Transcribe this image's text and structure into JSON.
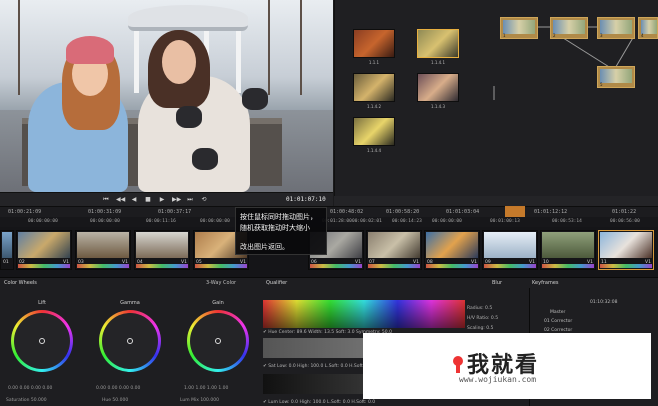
{
  "viewer": {
    "timecode": "01:01:07:10"
  },
  "transport": {
    "controls": [
      "⏮",
      "◀◀",
      "◀",
      "■",
      "▶",
      "▶▶",
      "⏭",
      "⟲"
    ]
  },
  "gallery": {
    "stills": [
      {
        "label": "1.1.1"
      },
      {
        "label": "1.1.4.1"
      },
      {
        "label": "1.1.4.2"
      },
      {
        "label": "1.1.4.3"
      },
      {
        "label": "1.1.4.4"
      }
    ]
  },
  "nodes": [
    {
      "label": "1"
    },
    {
      "label": "2"
    },
    {
      "label": "3"
    },
    {
      "label": "4"
    },
    {
      "label": "5"
    }
  ],
  "timeline": {
    "ruler_ticks": [
      "01:00:21:09",
      "01:00:31:09",
      "01:00:37:17",
      "01:00:48:02",
      "01:00:58:20",
      "01:01:03:04",
      "01:01:12:12",
      "01:01:22"
    ],
    "clip_times": [
      "00:00:00:00",
      "00:00:00:00",
      "00:00:11:16",
      "00:00:00:00",
      "00:01:28:00",
      "00:00:02:01",
      "00:00:14:23",
      "00:00:00:00",
      "00:01:00:13",
      "00:00:53:14",
      "00:00:56:00"
    ],
    "clips": [
      {
        "num": "01",
        "codec": ""
      },
      {
        "num": "02",
        "codec": "V1"
      },
      {
        "num": "03",
        "codec": "V1"
      },
      {
        "num": "04",
        "codec": "V1"
      },
      {
        "num": "05",
        "codec": "V1"
      },
      {
        "num": "06",
        "codec": "V1"
      },
      {
        "num": "07",
        "codec": "V1"
      },
      {
        "num": "08",
        "codec": "V1"
      },
      {
        "num": "09",
        "codec": "V1"
      },
      {
        "num": "10",
        "codec": "V1"
      },
      {
        "num": "11",
        "codec": "V1"
      },
      {
        "num": "12",
        "codec": "V1"
      }
    ]
  },
  "callout": {
    "line1": "按住鼠标同时拖动图片，",
    "line2": "随机获取拖动时大缩小",
    "line3": "改出图片返回。"
  },
  "color_wheels": {
    "title": "Color Wheels",
    "wheels": [
      {
        "name": "Lift",
        "vals": "0.00   0.00   0.00   0.00"
      },
      {
        "name": "Gamma",
        "vals": "0.00   0.00   0.00   0.00"
      },
      {
        "name": "Gain",
        "vals": "1.00   1.00   1.00   1.00"
      }
    ],
    "footer": [
      "Saturation 50.000",
      "Hue 50.000",
      "Lum Mix 100.000"
    ],
    "dropdown": "3-Way Color"
  },
  "qualifier": {
    "title": "Qualifier",
    "hue_row": "✔ Hue   Center: 89.6   Width: 13.5   Soft: 3.0   Symmetry: 50.0",
    "sat_row": "✔ Sat   Low: 0.0   High: 100.0   L.Soft: 0.0   H.Soft: 0.0",
    "lum_row": "✔ Lum   Low: 0.0   High: 100.0   L.Soft: 0.0   H.Soft: 0.0"
  },
  "blur": {
    "title": "Blur",
    "rows": [
      "Radius: 0.5",
      "H/V Ratio: 0.5",
      "Scaling: 0.5"
    ]
  },
  "keyframes": {
    "title": "Keyframes",
    "timecode": "01:10:32:08",
    "rows": [
      "Master",
      "01 Corrector",
      "02 Corrector",
      "03 Corrector",
      "04 Corrector",
      "05 Corrector"
    ]
  },
  "watermark": {
    "text": "我就看",
    "url": "www.wojiukan.com"
  }
}
